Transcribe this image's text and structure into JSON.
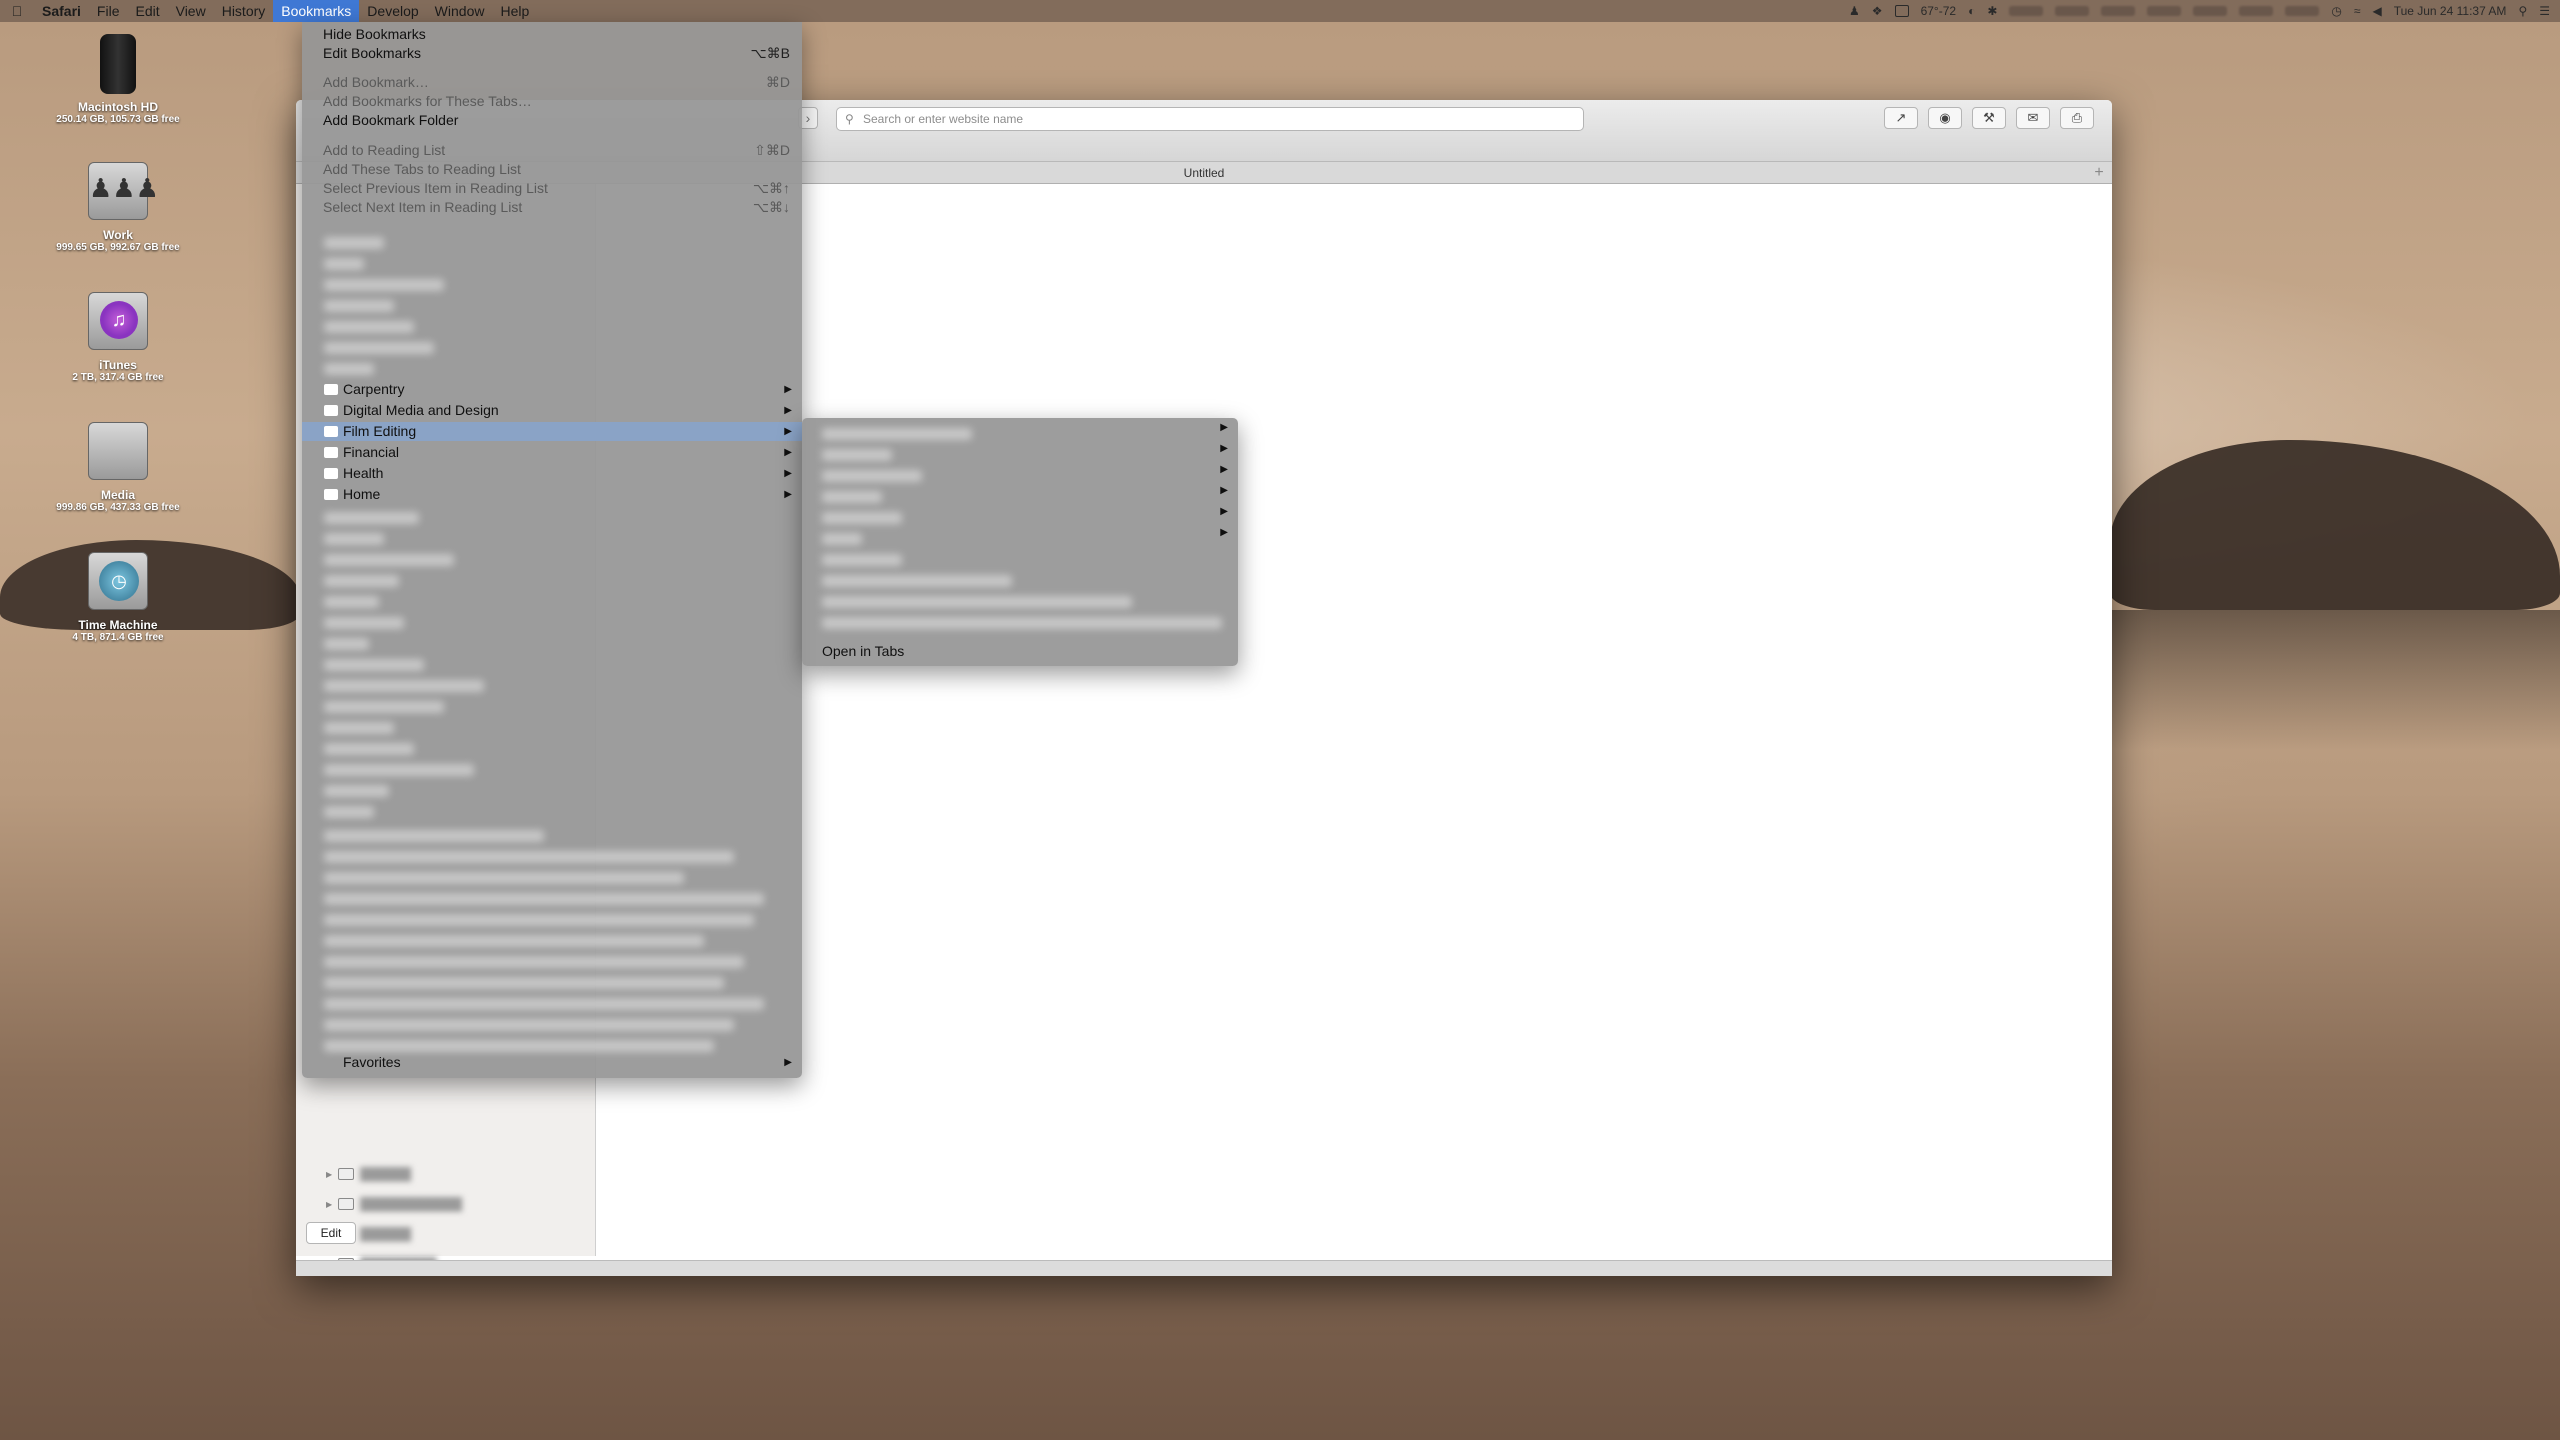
{
  "menubar": {
    "app": "Safari",
    "items": [
      "File",
      "Edit",
      "View",
      "History",
      "Bookmarks",
      "Develop",
      "Window",
      "Help"
    ],
    "active": "Bookmarks",
    "clock": "Tue Jun 24  11:37 AM",
    "temp": "67°-72"
  },
  "desktop": [
    {
      "name": "Macintosh HD",
      "sub": "250.14 GB, 105.73 GB free"
    },
    {
      "name": "Work",
      "sub": "999.65 GB, 992.67 GB free"
    },
    {
      "name": "iTunes",
      "sub": "2 TB, 317.4 GB free"
    },
    {
      "name": "Media",
      "sub": "999.86 GB, 437.33 GB free"
    },
    {
      "name": "Time Machine",
      "sub": "4 TB, 871.4 GB free"
    }
  ],
  "window": {
    "address_placeholder": "Search or enter website name",
    "tab_title": "Untitled",
    "edit_button": "Edit"
  },
  "bookmarks_menu": {
    "hide": "Hide Bookmarks",
    "edit": {
      "label": "Edit Bookmarks",
      "shortcut": "⌥⌘B"
    },
    "add_bookmark": {
      "label": "Add Bookmark…",
      "shortcut": "⌘D"
    },
    "add_for_tabs": "Add Bookmarks for These Tabs…",
    "add_folder": "Add Bookmark Folder",
    "add_reading": {
      "label": "Add to Reading List",
      "shortcut": "⇧⌘D"
    },
    "add_tabs_reading": "Add These Tabs to Reading List",
    "prev_reading": {
      "label": "Select Previous Item in Reading List",
      "shortcut": "⌥⌘↑"
    },
    "next_reading": {
      "label": "Select Next Item in Reading List",
      "shortcut": "⌥⌘↓"
    },
    "folders": [
      "Carpentry",
      "Digital Media and Design",
      "Film Editing",
      "Financial",
      "Health",
      "Home"
    ],
    "highlighted": "Film Editing",
    "favorites": "Favorites"
  },
  "submenu": {
    "open_in_tabs": "Open in Tabs"
  },
  "icons": {
    "apple": "apple-icon",
    "wifi": "wifi-icon",
    "search": "search-icon",
    "share": "share-icon",
    "print": "print-icon",
    "mail": "mail-icon"
  }
}
